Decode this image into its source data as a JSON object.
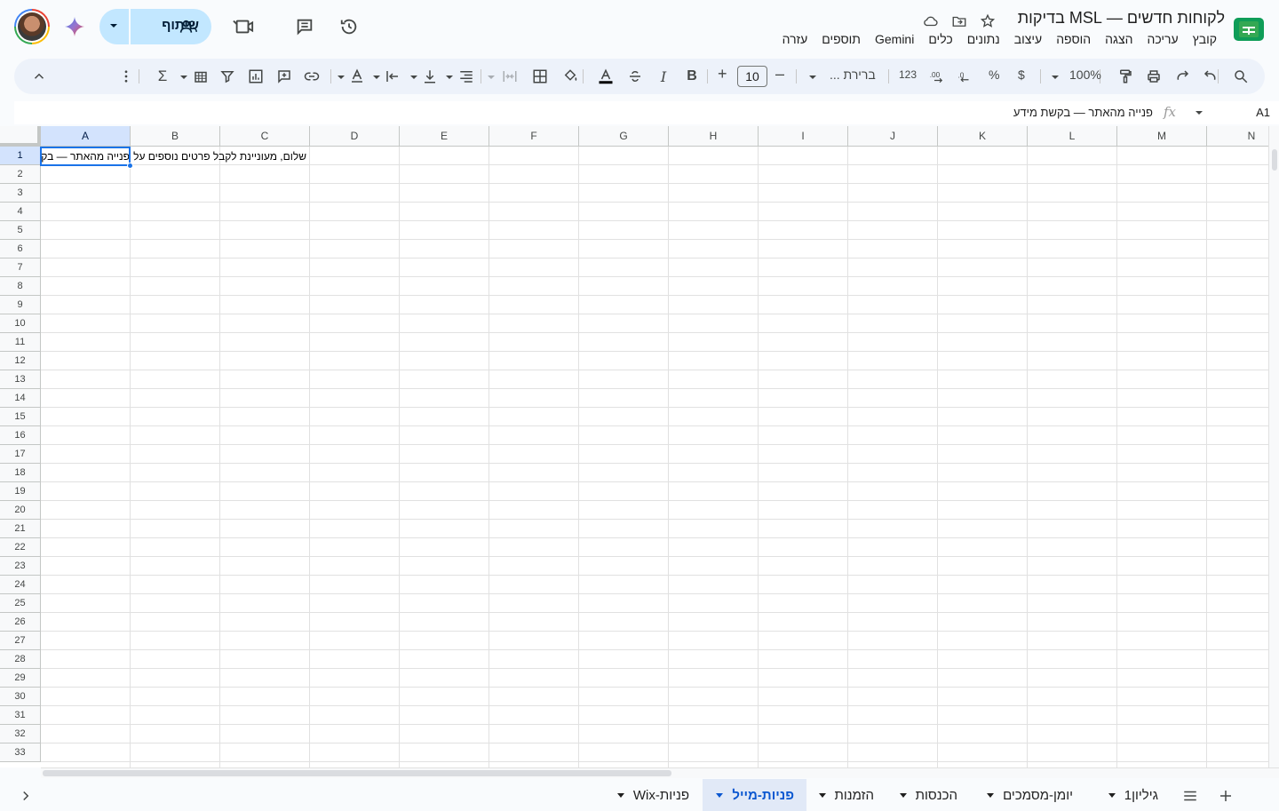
{
  "window": {
    "title": "לקוחות חדשים — MSL בדיקות"
  },
  "menu": [
    "קובץ",
    "עריכה",
    "הצגה",
    "הוספה",
    "עיצוב",
    "נתונים",
    "כלים",
    "Gemini",
    "תוספים",
    "עזרה"
  ],
  "header": {
    "share_label": "שיתוף"
  },
  "toolbar": {
    "zoom": "100%",
    "currency": "$",
    "percent": "%",
    "decimal_dec": ".0",
    "decimal_inc": ".00",
    "number_format": "123",
    "font_family": "ברירת ...",
    "font_size": "10",
    "minus": "–",
    "plus": "+"
  },
  "formula_bar": {
    "cell_ref": "A1",
    "fx": "fx",
    "content": "פנייה מהאתר — בקשת מידע"
  },
  "columns": [
    "A",
    "B",
    "C",
    "D",
    "E",
    "F",
    "G",
    "H",
    "I",
    "J",
    "K",
    "L",
    "M",
    "N"
  ],
  "rows": [
    "1",
    "2",
    "3",
    "4",
    "5",
    "6",
    "7",
    "8",
    "9",
    "10",
    "11",
    "12",
    "13",
    "14",
    "15",
    "16",
    "17",
    "18",
    "19",
    "20",
    "21",
    "22",
    "23",
    "24",
    "25",
    "26",
    "27",
    "28",
    "29",
    "30",
    "31",
    "32",
    "33"
  ],
  "cells": {
    "A1": "פנייה מהאתר — בקשת מידע",
    "B1": "שלום, מעוניינת לקבל פרטים נוספים על"
  },
  "sheets": {
    "add_icon": "plus-icon",
    "list_icon": "menu-icon",
    "tabs": [
      {
        "label": "גיליון1",
        "active": false
      },
      {
        "label": "יומן-מסמכים",
        "active": false
      },
      {
        "label": "הכנסות",
        "active": false
      },
      {
        "label": "הזמנות",
        "active": false
      },
      {
        "label": "פניות-מייל",
        "active": true
      },
      {
        "label": "פניות-Wix",
        "active": false
      }
    ]
  },
  "colors": {
    "accent": "#1a73e8",
    "share_bg": "#c2e7ff",
    "toolbar_bg": "#edf2fa",
    "logo_green": "#0f9d58"
  }
}
